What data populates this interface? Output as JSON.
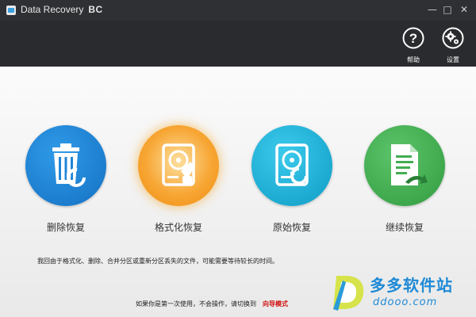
{
  "window": {
    "title": "Data Recovery",
    "title_suffix": "BC",
    "minimize_symbol": "—",
    "maximize_symbol": "□",
    "close_symbol": "✕"
  },
  "toolbar": {
    "help_label": "帮助",
    "help_symbol": "?",
    "settings_label": "设置"
  },
  "tiles": [
    {
      "label": "删除恢复",
      "icon": "trash-restore-icon",
      "color": "#1f86d8"
    },
    {
      "label": "格式化恢复",
      "icon": "disk-format-icon",
      "color": "#f5a623"
    },
    {
      "label": "原始恢复",
      "icon": "disk-raw-icon",
      "color": "#19b2d8"
    },
    {
      "label": "继续恢复",
      "icon": "document-continue-icon",
      "color": "#43ad52"
    }
  ],
  "hint_text": "我回由于格式化、删除、合并分区或重新分区丢失的文件，可能需要等待较长的时间。",
  "footer": {
    "text": "如果你是第一次使用，不会操作，请切换到",
    "link": "向导模式"
  },
  "watermark": {
    "title": "多多软件站",
    "url": "ddooo.com"
  }
}
